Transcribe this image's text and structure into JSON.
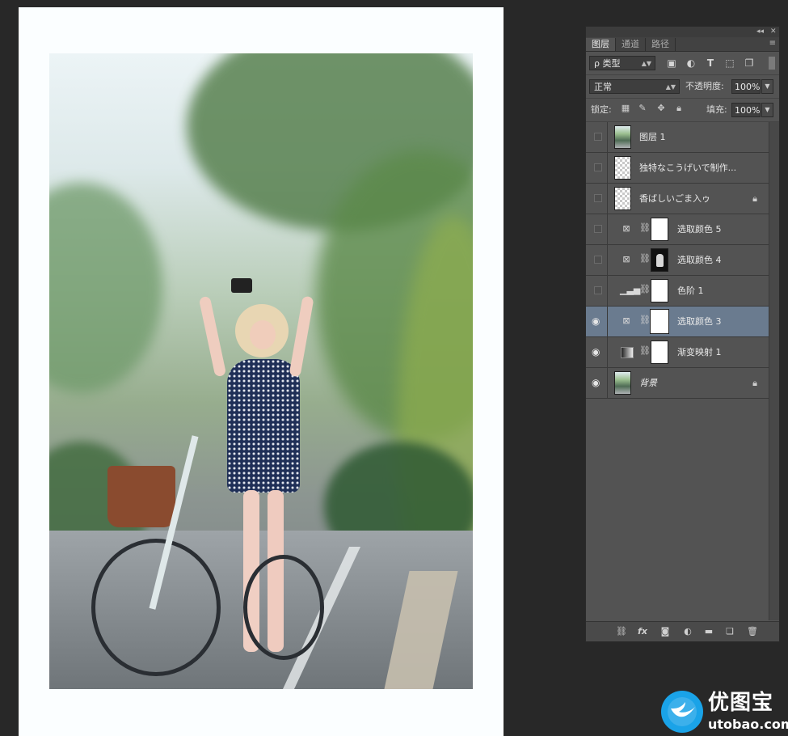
{
  "panel": {
    "top_controls": [
      "◂◂",
      "✕"
    ],
    "tabs": [
      {
        "label": "图层",
        "active": true
      },
      {
        "label": "通道",
        "active": false
      },
      {
        "label": "路径",
        "active": false
      }
    ],
    "menu_icon": "≡",
    "filter": {
      "icon": "ρ",
      "value": "类型"
    },
    "filter_icons": [
      "image-filter-icon",
      "adjustment-filter-icon",
      "type-filter-icon",
      "shape-filter-icon",
      "smart-object-filter-icon"
    ],
    "blend_mode": "正常",
    "opacity_label": "不透明度:",
    "opacity_value": "100%",
    "lock_label": "锁定:",
    "fill_label": "填充:",
    "fill_value": "100%"
  },
  "layers": [
    {
      "name": "图层 1",
      "visible": false,
      "thumb": "photo",
      "adjust": null,
      "mask": null,
      "locked": false,
      "selected": false,
      "italic": false
    },
    {
      "name": "独特なこうげいで制作...",
      "visible": false,
      "thumb": "checker",
      "adjust": null,
      "mask": null,
      "locked": false,
      "selected": false,
      "italic": false
    },
    {
      "name": "香ばしいごま入ゥ",
      "visible": false,
      "thumb": "checker",
      "adjust": null,
      "mask": null,
      "locked": true,
      "selected": false,
      "italic": false
    },
    {
      "name": "选取颜色 5",
      "visible": false,
      "thumb": null,
      "adjust": "selective-color",
      "mask": "white",
      "locked": false,
      "selected": false,
      "italic": false
    },
    {
      "name": "选取颜色 4",
      "visible": false,
      "thumb": null,
      "adjust": "selective-color",
      "mask": "dark",
      "locked": false,
      "selected": false,
      "italic": false
    },
    {
      "name": "色阶 1",
      "visible": false,
      "thumb": null,
      "adjust": "levels",
      "mask": "white",
      "locked": false,
      "selected": false,
      "italic": false
    },
    {
      "name": "选取颜色 3",
      "visible": true,
      "thumb": null,
      "adjust": "selective-color",
      "mask": "white",
      "locked": false,
      "selected": true,
      "italic": false
    },
    {
      "name": "渐变映射 1",
      "visible": true,
      "thumb": null,
      "adjust": "gradient-map",
      "mask": "white",
      "locked": false,
      "selected": false,
      "italic": false
    },
    {
      "name": "背景",
      "visible": true,
      "thumb": "photo",
      "adjust": null,
      "mask": null,
      "locked": true,
      "selected": false,
      "italic": true
    }
  ],
  "bottom_icons": [
    "link-layers-icon",
    "fx-icon",
    "add-mask-icon",
    "new-adjustment-icon",
    "new-group-icon",
    "new-layer-icon",
    "trash-icon"
  ],
  "watermark": {
    "title": "优图宝",
    "url": "utobao.com"
  },
  "colors": {
    "accent_selected": "#6a7b8f",
    "watermark_blue": "#1aa3e8",
    "panel_bg": "#535353"
  }
}
